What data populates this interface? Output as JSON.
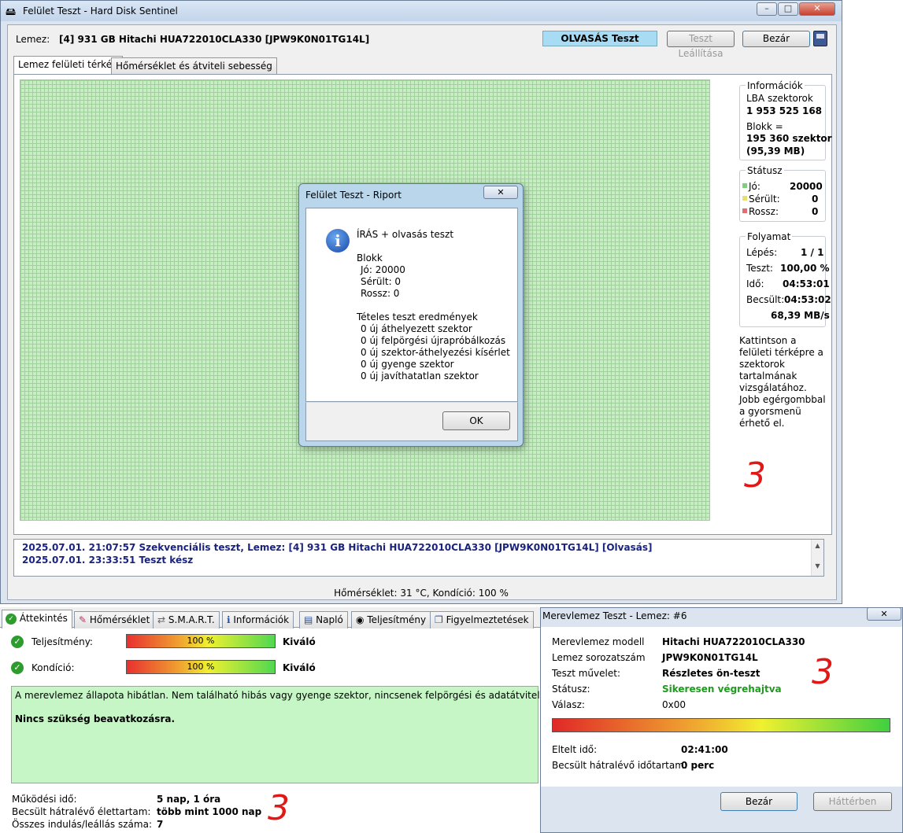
{
  "main": {
    "title": "Felület Teszt - Hard Disk Sentinel",
    "win_buttons": [
      "–",
      "□",
      "✕"
    ],
    "disk_label": "Lemez:",
    "disk_value": "[4] 931 GB  Hitachi HUA722010CLA330 [JPW9K0N01TG14L]",
    "status_text": "OLVASÁS Teszt",
    "stop_button": "Teszt Leállítása",
    "close_button": "Bezár",
    "tabs": [
      "Lemez felületi térkép",
      "Hőmérséklet és átviteli sebesség"
    ],
    "info": {
      "header": "Információk",
      "lba_label": "LBA szektorok",
      "lba_value": "1 953 525 168",
      "block_label": "Blokk =",
      "block_value1": "195 360 szektor",
      "block_value2": "(95,39 MB)"
    },
    "status": {
      "header": "Státusz",
      "good_label": "Jó:",
      "good_value": "20000",
      "damaged_label": "Sérült:",
      "damaged_value": "0",
      "bad_label": "Rossz:",
      "bad_value": "0"
    },
    "progress": {
      "header": "Folyamat",
      "step_label": "Lépés:",
      "step_value": "1 / 1",
      "test_label": "Teszt:",
      "test_value": "100,00 %",
      "time_label": "Idő:",
      "time_value": "04:53:01",
      "est_label": "Becsült:",
      "est_value": "04:53:02",
      "speed": "68,39 MB/s"
    },
    "hint1": "Kattintson a felületi térképre a szektorok tartalmának vizsgálatához.",
    "hint2": "Jobb egérgombbal a gyorsmenü érhető el.",
    "log": [
      "2025.07.01.  21:07:57   Szekvenciális teszt, Lemez: [4] 931 GB  Hitachi HUA722010CLA330 [JPW9K0N01TG14L] [Olvasás]",
      "2025.07.01.  23:33:51   Teszt kész"
    ],
    "statusbar": "Hőmérséklet: 31  °C,  Kondíció: 100 %"
  },
  "report": {
    "title": "Felület Teszt - Riport",
    "line1": "ÍRÁS + olvasás teszt",
    "blokk": "Blokk",
    "jo": "Jó: 20000",
    "serult": "Sérült: 0",
    "rossz": "Rossz: 0",
    "tetel": "Tételes teszt eredmények",
    "r1": "0 új áthelyezett szektor",
    "r2": "0 új felpörgési újrapróbálkozás",
    "r3": "0 új szektor-áthelyezési kísérlet",
    "r4": "0 új gyenge szektor",
    "r5": "0 új javíthatatlan szektor",
    "ok": "OK"
  },
  "overview": {
    "tabs": [
      "Áttekintés",
      "Hőmérséklet",
      "S.M.A.R.T.",
      "Információk",
      "Napló",
      "Teljesítmény",
      "Figyelmeztetések"
    ],
    "perf_label": "Teljesítmény:",
    "perf_pct": "100 %",
    "perf_text": "Kiváló",
    "perf_value": 1.0,
    "cond_label": "Kondíció:",
    "cond_pct": "100 %",
    "cond_text": "Kiváló",
    "cond_value": 1.0,
    "message": "A merevlemez állapota hibátlan. Nem található hibás vagy gyenge szektor, nincsenek felpörgési és adatátviteli hibák sem.",
    "message2": "Nincs szükség beavatkozásra.",
    "uptime_label": "Működési idő:",
    "uptime_value": "5 nap, 1 óra",
    "life_label": "Becsült hátralévő élettartam:",
    "life_value": "több mint 1000 nap",
    "starts_label": "Összes indulás/leállás száma:",
    "starts_value": "7"
  },
  "selftest": {
    "title": "Merevlemez Teszt - Lemez: #6",
    "model_label": "Merevlemez modell",
    "model_value": "Hitachi HUA722010CLA330",
    "serial_label": "Lemez sorozatszám",
    "serial_value": "JPW9K0N01TG14L",
    "op_label": "Teszt művelet:",
    "op_value": "Részletes ön-teszt",
    "status_label": "Státusz:",
    "status_value": "Sikeresen végrehajtva",
    "resp_label": "Válasz:",
    "resp_value": "0x00",
    "elapsed_label": "Eltelt idő:",
    "elapsed_value": "02:41:00",
    "remain_label": "Becsült hátralévő időtartam:",
    "remain_value": "0 perc",
    "close_button": "Bezár",
    "bg_button": "Háttérben",
    "progress": 1.0
  },
  "scribbles": [
    "3",
    "3",
    "3"
  ],
  "colors": {
    "good": "#7ed07a",
    "damaged": "#e8e070",
    "bad": "#e07070",
    "status_bg": "#a8dcf4",
    "msg_bg": "#c6f5c6"
  }
}
